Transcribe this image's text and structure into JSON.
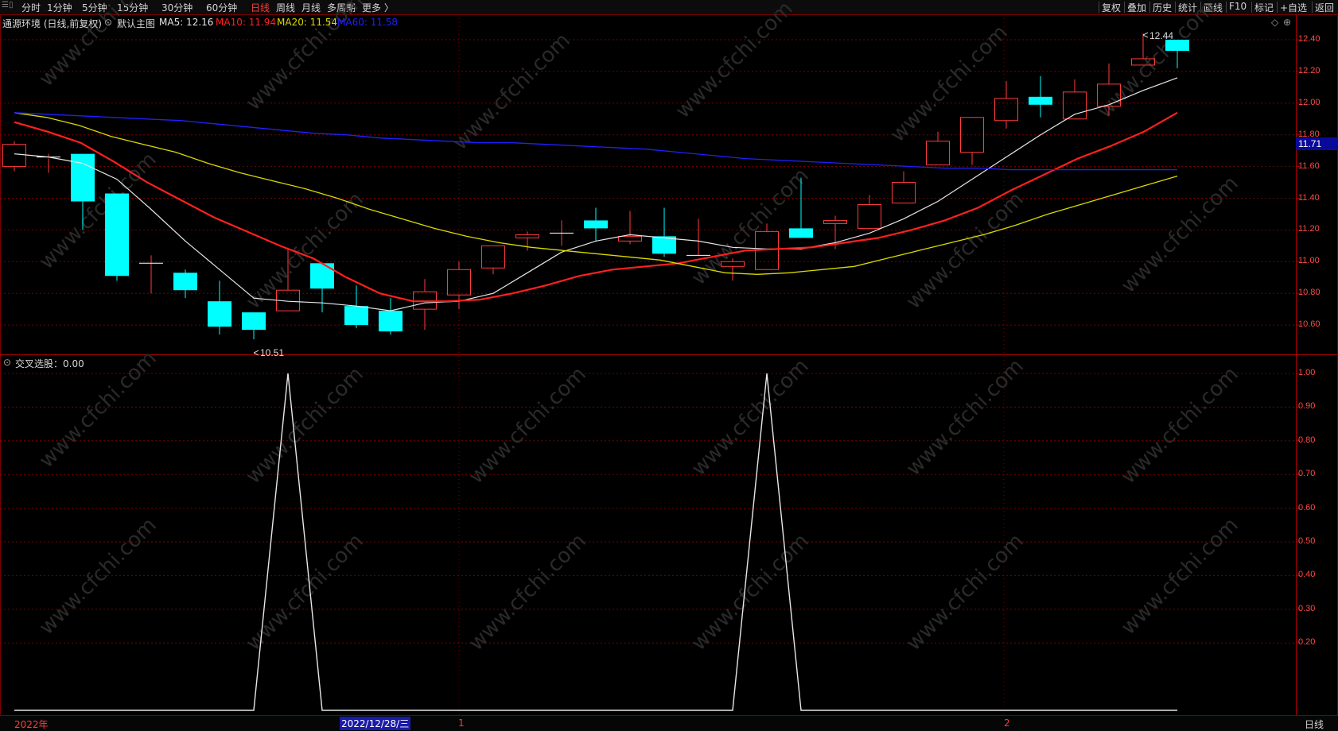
{
  "toolbar": {
    "periods": [
      {
        "label": "分时",
        "active": false
      },
      {
        "label": "1分钟",
        "active": false
      },
      {
        "label": "5分钟",
        "active": false
      },
      {
        "label": "15分钟",
        "active": false
      },
      {
        "label": "30分钟",
        "active": false
      },
      {
        "label": "60分钟",
        "active": false
      },
      {
        "label": "日线",
        "active": true
      },
      {
        "label": "周线",
        "active": false
      },
      {
        "label": "月线",
        "active": false
      },
      {
        "label": "多周期",
        "active": false
      },
      {
        "label": "更多 〉",
        "active": false
      }
    ],
    "right_buttons": [
      "复权",
      "叠加",
      "历史",
      "统计",
      "画线",
      "F10",
      "标记",
      "+自选",
      "返回"
    ]
  },
  "main_header": {
    "stock": "通源环境 (日线,前复权)",
    "template": "默认主图",
    "ma5": "MA5: 12.16",
    "ma10": "MA10: 11.94",
    "ma20": "MA20: 11.54",
    "ma60": "MA60: 11.58"
  },
  "sub_header": {
    "indicator": "交叉选股：0.00"
  },
  "colors": {
    "up": "#ff3b3b",
    "down": "#00ffff",
    "ma5": "#e6e6e6",
    "ma10": "#ff2020",
    "ma20": "#d9d900",
    "ma60": "#2020ff",
    "grid": "#7a0000"
  },
  "price_axis": [
    "12.40",
    "12.20",
    "12.00",
    "11.80",
    "11.60",
    "11.40",
    "11.20",
    "11.00",
    "10.80",
    "10.60"
  ],
  "current_price": "11.71",
  "annotations": {
    "high": "12.44",
    "low": "10.51"
  },
  "sub_axis": [
    "1.00",
    "0.90",
    "0.80",
    "0.70",
    "0.60",
    "0.50",
    "0.40",
    "0.30",
    "0.20"
  ],
  "bottom": {
    "year": "2022年",
    "selected_date": "2022/12/28/三",
    "month1": "1",
    "month2": "2",
    "period_btn": "日线"
  },
  "watermark": "www.cfchi.com",
  "chart_data": [
    {
      "type": "candlestick",
      "ylim": [
        10.5,
        12.45
      ],
      "candles": [
        {
          "o": 11.6,
          "h": 11.76,
          "l": 11.57,
          "c": 11.74
        },
        {
          "o": 11.65,
          "h": 11.68,
          "l": 11.56,
          "c": 11.66
        },
        {
          "o": 11.68,
          "h": 11.68,
          "l": 11.2,
          "c": 11.38
        },
        {
          "o": 11.43,
          "h": 11.43,
          "l": 10.88,
          "c": 10.91
        },
        {
          "o": 10.99,
          "h": 11.04,
          "l": 10.8,
          "c": 10.99
        },
        {
          "o": 10.93,
          "h": 10.95,
          "l": 10.77,
          "c": 10.82
        },
        {
          "o": 10.75,
          "h": 10.88,
          "l": 10.54,
          "c": 10.59
        },
        {
          "o": 10.68,
          "h": 10.68,
          "l": 10.51,
          "c": 10.57
        },
        {
          "o": 10.69,
          "h": 11.08,
          "l": 10.69,
          "c": 10.82
        },
        {
          "o": 10.99,
          "h": 10.99,
          "l": 10.68,
          "c": 10.83
        },
        {
          "o": 10.72,
          "h": 10.85,
          "l": 10.58,
          "c": 10.6
        },
        {
          "o": 10.69,
          "h": 10.77,
          "l": 10.54,
          "c": 10.56
        },
        {
          "o": 10.7,
          "h": 10.89,
          "l": 10.57,
          "c": 10.81
        },
        {
          "o": 10.79,
          "h": 11.0,
          "l": 10.7,
          "c": 10.95
        },
        {
          "o": 10.96,
          "h": 11.1,
          "l": 10.92,
          "c": 11.1
        },
        {
          "o": 11.15,
          "h": 11.19,
          "l": 11.07,
          "c": 11.17
        },
        {
          "o": 11.18,
          "h": 11.26,
          "l": 11.1,
          "c": 11.18
        },
        {
          "o": 11.26,
          "h": 11.34,
          "l": 11.13,
          "c": 11.21
        },
        {
          "o": 11.13,
          "h": 11.32,
          "l": 11.11,
          "c": 11.16
        },
        {
          "o": 11.16,
          "h": 11.34,
          "l": 11.03,
          "c": 11.05
        },
        {
          "o": 11.04,
          "h": 11.27,
          "l": 11.04,
          "c": 11.04
        },
        {
          "o": 10.97,
          "h": 11.02,
          "l": 10.88,
          "c": 11.0
        },
        {
          "o": 10.95,
          "h": 11.24,
          "l": 10.95,
          "c": 11.19
        },
        {
          "o": 11.21,
          "h": 11.53,
          "l": 11.15,
          "c": 11.15
        },
        {
          "o": 11.24,
          "h": 11.29,
          "l": 11.08,
          "c": 11.26
        },
        {
          "o": 11.21,
          "h": 11.42,
          "l": 11.21,
          "c": 11.36
        },
        {
          "o": 11.37,
          "h": 11.57,
          "l": 11.37,
          "c": 11.5
        },
        {
          "o": 11.61,
          "h": 11.82,
          "l": 11.61,
          "c": 11.76
        },
        {
          "o": 11.69,
          "h": 11.91,
          "l": 11.61,
          "c": 11.91
        },
        {
          "o": 11.89,
          "h": 12.14,
          "l": 11.84,
          "c": 12.03
        },
        {
          "o": 12.04,
          "h": 12.17,
          "l": 11.91,
          "c": 11.99
        },
        {
          "o": 11.9,
          "h": 12.15,
          "l": 11.9,
          "c": 12.07
        },
        {
          "o": 11.98,
          "h": 12.25,
          "l": 11.92,
          "c": 12.12
        },
        {
          "o": 12.24,
          "h": 12.44,
          "l": 12.24,
          "c": 12.28
        },
        {
          "o": 12.4,
          "h": 12.4,
          "l": 12.22,
          "c": 12.33
        }
      ],
      "series": [
        {
          "name": "MA5",
          "values": [
            11.68,
            11.66,
            11.62,
            11.52,
            11.33,
            11.13,
            10.95,
            10.77,
            10.75,
            10.74,
            10.72,
            10.69,
            10.74,
            10.75,
            10.8,
            10.93,
            11.06,
            11.13,
            11.17,
            11.15,
            11.13,
            11.09,
            11.08,
            11.08,
            11.12,
            11.18,
            11.27,
            11.38,
            11.52,
            11.66,
            11.8,
            11.93,
            11.99,
            12.08,
            12.16
          ]
        },
        {
          "name": "MA10",
          "values": [
            11.88,
            11.82,
            11.75,
            11.63,
            11.5,
            11.39,
            11.28,
            11.19,
            11.1,
            11.02,
            10.9,
            10.8,
            10.75,
            10.75,
            10.76,
            10.8,
            10.85,
            10.91,
            10.95,
            10.97,
            10.99,
            11.03,
            11.07,
            11.08,
            11.09,
            11.12,
            11.15,
            11.2,
            11.26,
            11.34,
            11.45,
            11.55,
            11.65,
            11.73,
            11.82,
            11.94
          ]
        },
        {
          "name": "MA20",
          "values": [
            11.94,
            11.91,
            11.86,
            11.79,
            11.74,
            11.69,
            11.62,
            11.56,
            11.51,
            11.46,
            11.4,
            11.33,
            11.27,
            11.21,
            11.16,
            11.12,
            11.09,
            11.07,
            11.05,
            11.03,
            11.01,
            10.97,
            10.93,
            10.92,
            10.93,
            10.95,
            10.97,
            11.02,
            11.07,
            11.12,
            11.17,
            11.23,
            11.3,
            11.36,
            11.42,
            11.48,
            11.54
          ]
        },
        {
          "name": "MA60",
          "values": [
            11.94,
            11.93,
            11.92,
            11.91,
            11.9,
            11.89,
            11.87,
            11.85,
            11.83,
            11.81,
            11.8,
            11.78,
            11.77,
            11.76,
            11.75,
            11.75,
            11.74,
            11.73,
            11.72,
            11.71,
            11.69,
            11.67,
            11.65,
            11.64,
            11.63,
            11.62,
            11.61,
            11.6,
            11.59,
            11.59,
            11.58,
            11.58,
            11.58,
            11.58,
            11.58,
            11.58
          ]
        }
      ]
    },
    {
      "type": "line",
      "name": "交叉选股",
      "ylim": [
        0,
        1
      ],
      "values": [
        0,
        0,
        0,
        0,
        0,
        0,
        0,
        0,
        1,
        0,
        0,
        0,
        0,
        0,
        0,
        0,
        0,
        0,
        0,
        0,
        0,
        0,
        1,
        0,
        0,
        0,
        0,
        0,
        0,
        0,
        0,
        0,
        0,
        0,
        0
      ]
    }
  ]
}
